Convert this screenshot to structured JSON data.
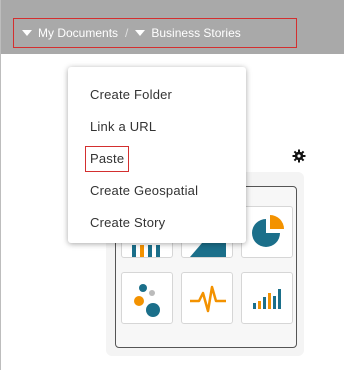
{
  "breadcrumb": {
    "items": [
      {
        "label": "My Documents"
      },
      {
        "label": "Business Stories"
      }
    ],
    "separator": "/"
  },
  "context_menu": {
    "items": [
      {
        "label": "Create Folder"
      },
      {
        "label": "Link a URL"
      },
      {
        "label": "Paste",
        "highlighted": true
      },
      {
        "label": "Create Geospatial"
      },
      {
        "label": "Create Story"
      }
    ]
  },
  "colors": {
    "topbar": "#a9a9a9",
    "accent_teal": "#1b6f8a",
    "accent_orange": "#f39200",
    "highlight_border": "#d32f2f"
  },
  "icons": {
    "settings": "gear-icon",
    "tiles": [
      "bar-chart-icon",
      "area-chart-icon",
      "pie-chart-icon",
      "scatter-icon",
      "pulse-icon",
      "column-chart-icon"
    ]
  }
}
